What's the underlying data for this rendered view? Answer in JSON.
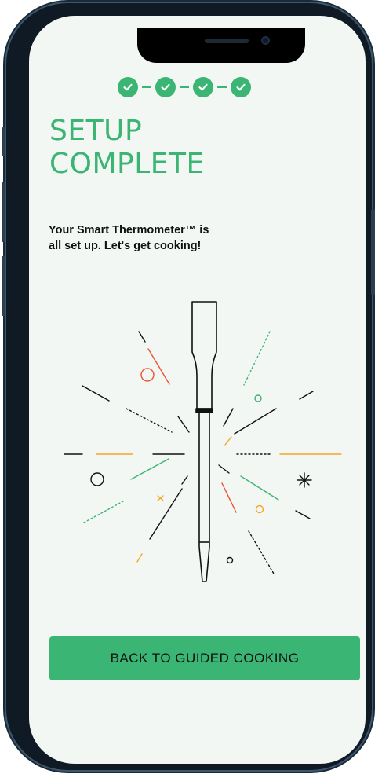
{
  "progress": {
    "steps_total": 4,
    "steps_completed": 4,
    "step_icon": "check-icon"
  },
  "header": {
    "title_line1": "SETUP",
    "title_line2": "COMPLETE"
  },
  "message": {
    "line1": "Your Smart Thermometer™ is",
    "line2": "all set up. Let's get cooking!"
  },
  "illustration": {
    "name": "thermometer-probe-burst-illustration"
  },
  "actions": {
    "primary_label": "BACK TO GUIDED COOKING"
  },
  "colors": {
    "brand_green": "#3bb573",
    "background": "#f2f7f4",
    "accent_orange": "#f4a623",
    "accent_red": "#f0522e",
    "ink": "#111111"
  }
}
